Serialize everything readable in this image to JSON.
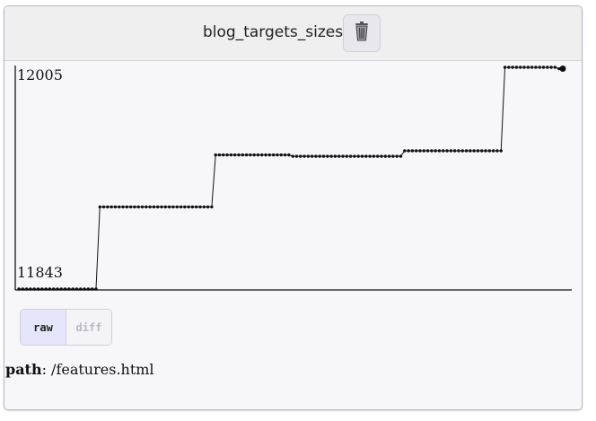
{
  "header": {
    "title": "blog_targets_sizes",
    "delete_icon": "trash-icon"
  },
  "chart_data": {
    "type": "line",
    "title": "",
    "xlabel": "",
    "ylabel": "",
    "y_labels": [
      "12005",
      "11843"
    ],
    "ylim": [
      11843,
      12005
    ],
    "grid": false,
    "series": [
      {
        "values": [
          11843,
          11843,
          11843,
          11843,
          11843,
          11843,
          11843,
          11843,
          11843,
          11843,
          11843,
          11843,
          11843,
          11843,
          11843,
          11843,
          11843,
          11843,
          11843,
          11843,
          11843,
          11903,
          11903,
          11903,
          11903,
          11903,
          11903,
          11903,
          11903,
          11903,
          11903,
          11903,
          11903,
          11903,
          11903,
          11903,
          11903,
          11903,
          11903,
          11903,
          11903,
          11903,
          11903,
          11903,
          11903,
          11903,
          11903,
          11903,
          11903,
          11903,
          11903,
          11941,
          11941,
          11941,
          11941,
          11941,
          11941,
          11941,
          11941,
          11941,
          11941,
          11941,
          11941,
          11941,
          11941,
          11941,
          11941,
          11941,
          11941,
          11941,
          11941,
          11940,
          11940,
          11940,
          11940,
          11940,
          11940,
          11940,
          11940,
          11940,
          11940,
          11940,
          11940,
          11940,
          11940,
          11940,
          11940,
          11940,
          11940,
          11940,
          11940,
          11940,
          11940,
          11940,
          11940,
          11940,
          11940,
          11940,
          11940,
          11940,
          11944,
          11944,
          11944,
          11944,
          11944,
          11944,
          11944,
          11944,
          11944,
          11944,
          11944,
          11944,
          11944,
          11944,
          11944,
          11944,
          11944,
          11944,
          11944,
          11944,
          11944,
          11944,
          11944,
          11944,
          11944,
          11944,
          12005,
          12005,
          12005,
          12005,
          12005,
          12005,
          12005,
          12005,
          12005,
          12005,
          12005,
          12005,
          12005,
          12005,
          12004,
          12004
        ]
      }
    ]
  },
  "toggle": {
    "raw_label": "raw",
    "diff_label": "diff"
  },
  "path": {
    "label": "path",
    "value": ": /features.html"
  }
}
